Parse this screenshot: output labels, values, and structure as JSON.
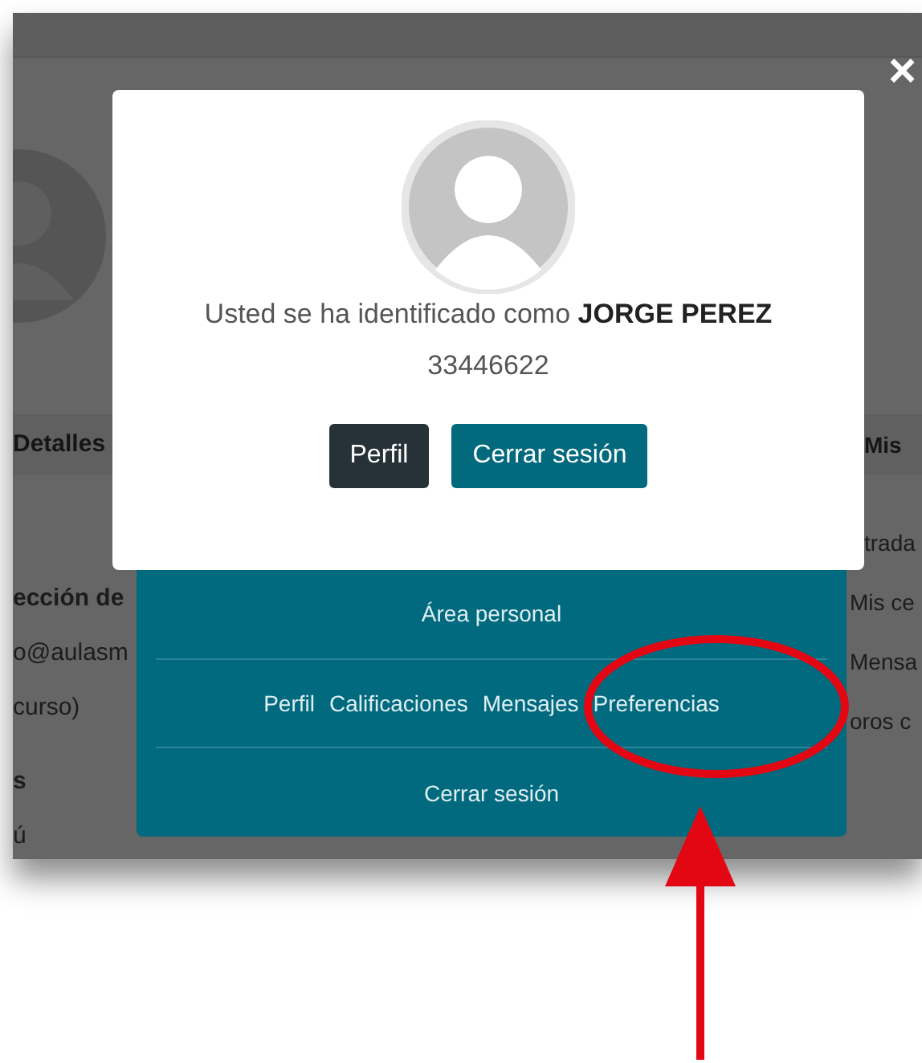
{
  "background_page": {
    "left_column": [
      {
        "kind": "heading",
        "text": "Detalles"
      },
      {
        "kind": "heading",
        "text": "ección de"
      },
      {
        "kind": "text",
        "text": "o@aulasm"
      },
      {
        "kind": "text",
        "text": "curso)"
      },
      {
        "kind": "heading",
        "text": "s"
      },
      {
        "kind": "text",
        "text": "ú"
      }
    ],
    "right_column": [
      {
        "kind": "heading",
        "text": "Mis"
      },
      {
        "kind": "text",
        "text": "trada"
      },
      {
        "kind": "text",
        "text": "Mis ce"
      },
      {
        "kind": "text",
        "text": "Mensa"
      },
      {
        "kind": "text",
        "text": "oros c"
      }
    ]
  },
  "close_button": "×",
  "modal": {
    "message": "Usted se ha identificado como **JORGE PEREZ**",
    "id_number": "33446622",
    "buttons": [
      {
        "label": "Perfil",
        "kind": "dark"
      },
      {
        "label": "Cerrar sesión",
        "kind": "primary"
      }
    ]
  },
  "user_menu": {
    "rows": [
      {
        "items": [
          "Área personal"
        ]
      },
      {
        "items": [
          "Perfil",
          "Calificaciones",
          "Mensajes",
          "Preferencias"
        ]
      },
      {
        "items": [
          "Cerrar sesión"
        ]
      }
    ]
  }
}
